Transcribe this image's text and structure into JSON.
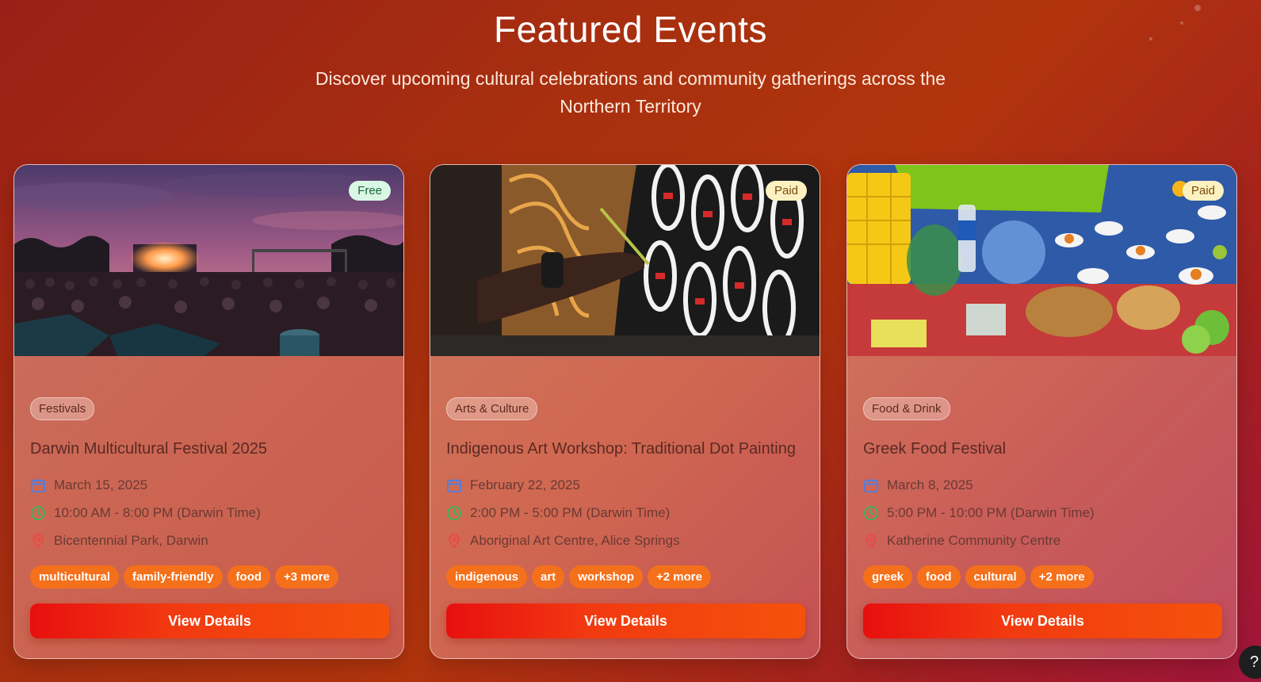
{
  "header": {
    "title": "Featured Events",
    "subtitle_line1": "Discover upcoming cultural celebrations and community gatherings across the",
    "subtitle_line2": "Northern Territory"
  },
  "events": [
    {
      "price": "Free",
      "category": "Festivals",
      "title": "Darwin Multicultural Festival 2025",
      "date": "March 15, 2025",
      "time": "10:00 AM - 8:00 PM (Darwin Time)",
      "location": "Bicentennial Park, Darwin",
      "tags": [
        "multicultural",
        "family-friendly",
        "food",
        "+3 more"
      ],
      "button": "View Details",
      "image": "concert-crowd-at-dusk"
    },
    {
      "price": "Paid",
      "category": "Arts & Culture",
      "title": "Indigenous Art Workshop: Traditional Dot Painting",
      "date": "February 22, 2025",
      "time": "2:00 PM - 5:00 PM (Darwin Time)",
      "location": "Aboriginal Art Centre, Alice Springs",
      "tags": [
        "indigenous",
        "art",
        "workshop",
        "+2 more"
      ],
      "button": "View Details",
      "image": "hand-painting-pattern"
    },
    {
      "price": "Paid",
      "category": "Food & Drink",
      "title": "Greek Food Festival",
      "date": "March 8, 2025",
      "time": "5:00 PM - 10:00 PM (Darwin Time)",
      "location": "Katherine Community Centre",
      "tags": [
        "greek",
        "food",
        "cultural",
        "+2 more"
      ],
      "button": "View Details",
      "image": "food-market-table"
    }
  ],
  "help_button": "?",
  "icons": {
    "date": "calendar-icon",
    "time": "clock-icon",
    "location": "map-pin-icon"
  },
  "colors": {
    "tag": "#f5701a",
    "button_start": "#e80f0f",
    "button_end": "#f4520c",
    "calendar_icon": "#3b82f6",
    "clock_icon": "#22c55e",
    "pin_icon": "#ef4444"
  }
}
